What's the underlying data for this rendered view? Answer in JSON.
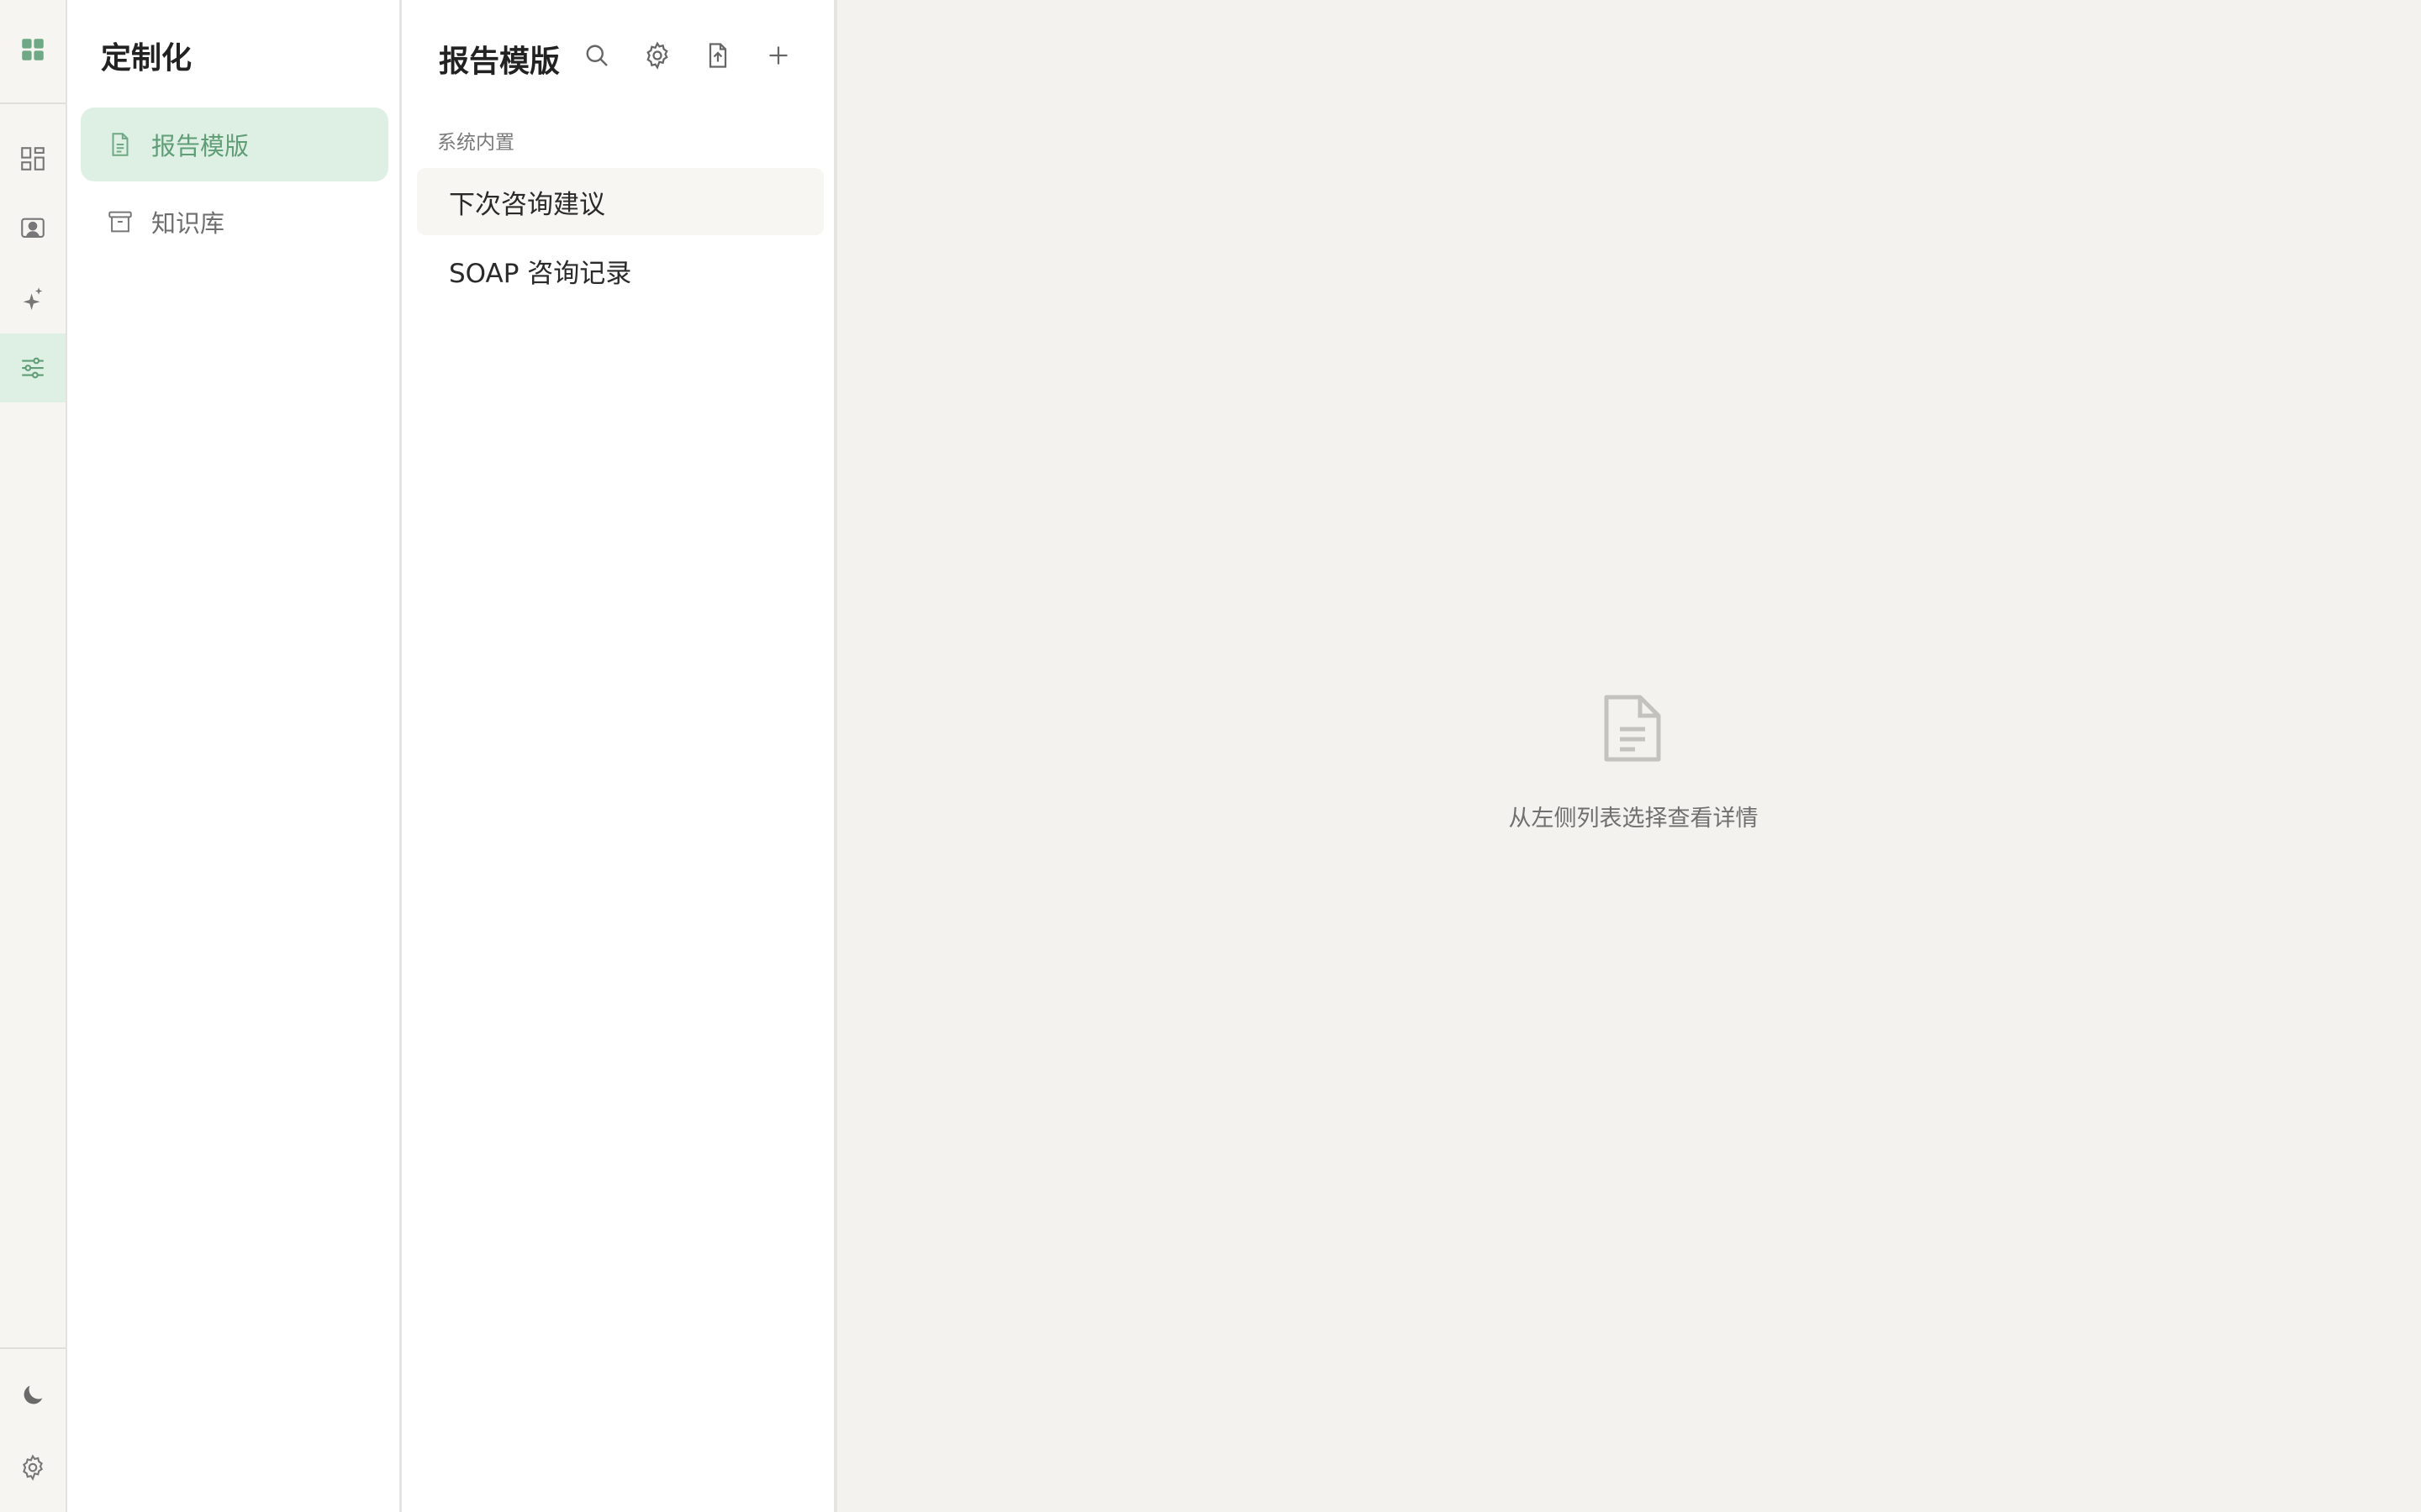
{
  "rail": {
    "items": [
      {
        "icon": "apps-grid-icon",
        "active": false
      },
      {
        "icon": "dashboard-icon",
        "active": false
      },
      {
        "icon": "client-card-icon",
        "active": false
      },
      {
        "icon": "sparkle-icon",
        "active": false
      },
      {
        "icon": "sliders-icon",
        "active": true
      }
    ],
    "bottom": [
      {
        "icon": "moon-icon"
      },
      {
        "icon": "gear-icon"
      }
    ]
  },
  "sidebar": {
    "title": "定制化",
    "items": [
      {
        "label": "报告模版",
        "icon": "document-icon",
        "active": true
      },
      {
        "label": "知识库",
        "icon": "archive-box-icon",
        "active": false
      }
    ]
  },
  "list": {
    "title": "报告模版",
    "tools": [
      "search-icon",
      "gear-icon",
      "upload-file-icon",
      "plus-icon"
    ],
    "section_label": "系统内置",
    "items": [
      {
        "label": "下次咨询建议"
      },
      {
        "label": "SOAP 咨询记录"
      }
    ]
  },
  "detail": {
    "empty_text": "从左侧列表选择查看详情",
    "icon": "document-icon"
  },
  "colors": {
    "accent": "#5f9e76",
    "accent_bg": "#deefe4",
    "page_bg": "#f4f2ee"
  }
}
